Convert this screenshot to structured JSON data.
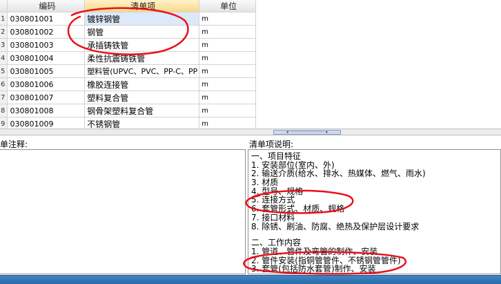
{
  "grid": {
    "columns": [
      "编码",
      "清单项",
      "单位"
    ],
    "rows": [
      {
        "num": "1",
        "code": "030801001",
        "name": "镀锌钢管",
        "unit": "m"
      },
      {
        "num": "2",
        "code": "030801002",
        "name": "钢管",
        "unit": "m"
      },
      {
        "num": "3",
        "code": "030801003",
        "name": "承插铸铁管",
        "unit": "m"
      },
      {
        "num": "4",
        "code": "030801004",
        "name": "柔性抗震铸铁管",
        "unit": "m"
      },
      {
        "num": "5",
        "code": "030801005",
        "name": "塑料管(UPVC、PVC、PP-C、PP",
        "unit": "m"
      },
      {
        "num": "6",
        "code": "030801006",
        "name": "橡胶连接管",
        "unit": "m"
      },
      {
        "num": "7",
        "code": "030801007",
        "name": "塑料复合管",
        "unit": "m"
      },
      {
        "num": "8",
        "code": "030801008",
        "name": "钢骨架塑料复合管",
        "unit": "m"
      },
      {
        "num": "9",
        "code": "030801009",
        "name": "不锈钢管",
        "unit": "m"
      }
    ]
  },
  "splitter": {
    "handle_glyph": "▾ ·························· ▾"
  },
  "notes": {
    "label": "单注释:",
    "content": ""
  },
  "description": {
    "label": "清单项说明:",
    "features_lines": [
      "一、项目特征",
      "1. 安装部位(室内、外)",
      "2. 输送介质(给水、排水、热媒体、燃气、雨水)",
      "3. 材质",
      "4. 型号、规格",
      "5. 连接方式",
      "6. 套管形式、材质、规格",
      "7. 接口材料",
      "8. 除锈、刷油、防腐、绝热及保护层设计要求"
    ],
    "work_lines": [
      "二、工作内容",
      "1. 管道、管件及弯管的制作、安装",
      "2. 管件安装(指铜管管件、不锈钢管管件)",
      "3. 套管(包括防水套管)制作、安装"
    ]
  },
  "colors": {
    "annotation": "#e8101a",
    "selected_row": "#dce9f8",
    "status_bar": "#2c6aa8"
  }
}
